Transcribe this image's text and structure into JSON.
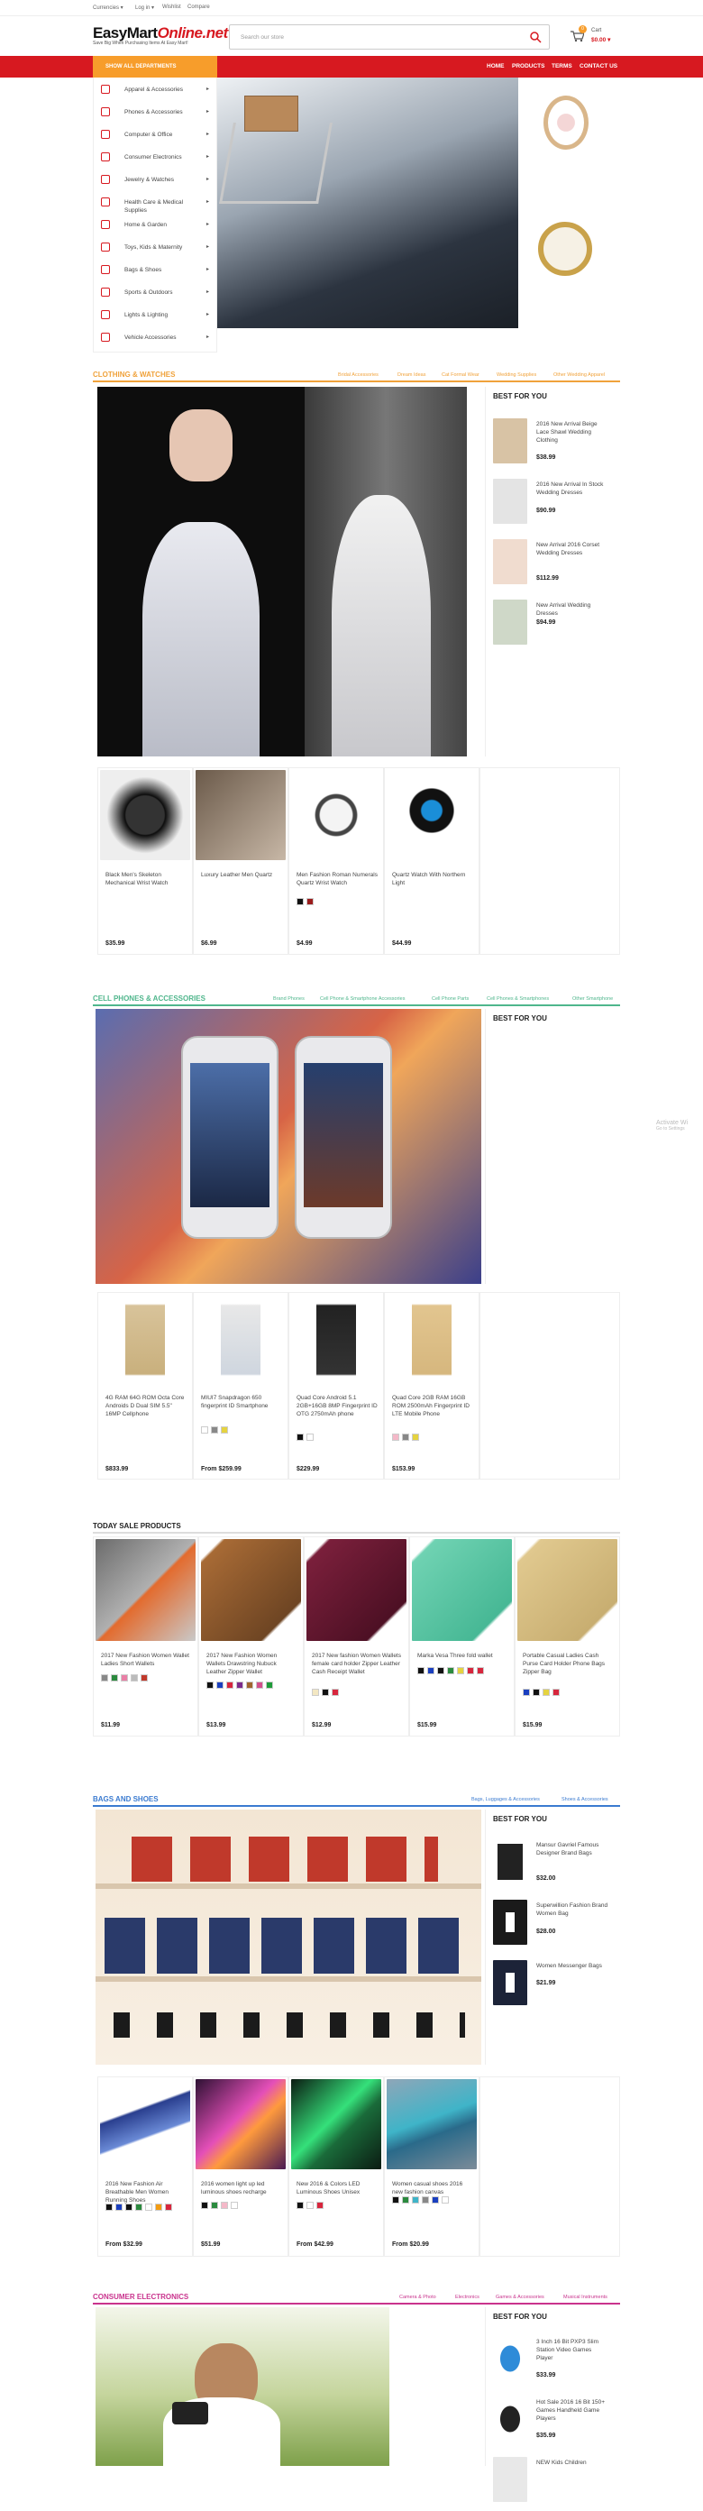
{
  "topbar": {
    "currency": "Currencies ▾",
    "login": "Log in ▾",
    "wishlist": "Wishlist",
    "compare": "Compare"
  },
  "logo": {
    "easy": "EasyMart",
    "online": "Online.net",
    "tagline": "Save Big When Purchasing Items At Easy Mart!"
  },
  "search": {
    "placeholder": "Search our store"
  },
  "cart": {
    "count": "0",
    "label": "Cart",
    "total": "$0.00 ▾"
  },
  "nav": {
    "all_departments": "SHOW ALL DEPARTMENTS",
    "items": [
      "HOME",
      "PRODUCTS",
      "TERMS",
      "CONTACT US"
    ]
  },
  "sidemenu": [
    "Apparel & Accessories",
    "Phones & Accessories",
    "Computer & Office",
    "Consumer Electronics",
    "Jewelry & Watches",
    "Health Care & Medical Supplies",
    "Home & Garden",
    "Toys, Kids & Maternity",
    "Bags & Shoes",
    "Sports & Outdoors",
    "Lights & Lighting",
    "Vehicle Accessories"
  ],
  "watermark": {
    "line1": "Activate Wi",
    "line2": "Go to Settings"
  },
  "clothing": {
    "title": "CLOTHING & WATCHES",
    "color": "#f0a23b",
    "tabs": [
      "Bridal Accessories",
      "Dream Ideas",
      "Cat Formal Wear",
      "Wedding Supplies",
      "Other Wedding Apparel"
    ],
    "best_for_you": "BEST FOR YOU",
    "bfy": [
      {
        "title": "2016 New Arrival Beige Lace Shawl Wedding Clothing",
        "price": "$38.99"
      },
      {
        "title": "2016 New Arrival In Stock Wedding Dresses",
        "price": "$90.99"
      },
      {
        "title": "New Arrival 2016 Corset Wedding Dresses",
        "price": "$112.99"
      },
      {
        "title": "New Arrival Wedding Dresses",
        "price": "$94.99"
      }
    ],
    "products": [
      {
        "title": "Black Men's Skeleton Mechanical Wrist Watch",
        "price": "$35.99"
      },
      {
        "title": "Luxury Leather Men Quartz",
        "price": "$6.99"
      },
      {
        "title": "Men Fashion Roman Numerals Quartz Wrist Watch",
        "price": "$4.99"
      },
      {
        "title": "Quartz Watch With Northern Light",
        "price": "$44.99"
      }
    ]
  },
  "phones": {
    "title": "CELL PHONES & ACCESSORIES",
    "color": "#4fb68c",
    "tabs": [
      "Brand Phones",
      "Cell Phone & Smartphone Accessories",
      "Cell Phone Parts",
      "Cell Phones & Smartphones",
      "Other Smartphone"
    ],
    "best_for_you": "BEST FOR YOU",
    "products": [
      {
        "title": "4G RAM 64G ROM Octa Core Androids D Dual SIM 5.5\" 16MP Cellphone",
        "price": "$833.99"
      },
      {
        "title": "MIUI7 Snapdragon 650 fingerprint ID Smartphone",
        "price": "From $259.99"
      },
      {
        "title": "Quad Core Android 5.1 2GB+16GB 8MP Fingerprint ID OTG 2750mAh phone",
        "price": "$229.99"
      },
      {
        "title": "Quad Core 2GB RAM 16GB ROM 2500mAh Fingerprint ID LTE Mobile Phone",
        "price": "$153.99"
      }
    ]
  },
  "today": {
    "title": "TODAY SALE PRODUCTS",
    "products": [
      {
        "title": "2017 New Fashion Women Wallet Ladies Short Wallets",
        "price": "$11.99"
      },
      {
        "title": "2017 New Fashion Women Wallets Drawstring Nubuck Leather Zipper Wallet",
        "price": "$13.99"
      },
      {
        "title": "2017 New fashion Women Wallets female card holder Zipper Leather Cash Receipt Wallet",
        "price": "$12.99"
      },
      {
        "title": "Marka Vesa Three fold wallet",
        "price": "$15.99"
      },
      {
        "title": "Portable Casual Ladies Cash Purse Card Holder Phone Bags Zipper Bag",
        "price": "$15.99"
      }
    ]
  },
  "bags": {
    "title": "BAGS AND SHOES",
    "color": "#3b7bd0",
    "tabs": [
      "Bags, Luggages & Accessories",
      "Shoes & Accessories"
    ],
    "best_for_you": "BEST FOR YOU",
    "bfy": [
      {
        "title": "Mansur Gavriel Famous Designer Brand Bags",
        "price": "$32.00"
      },
      {
        "title": "Superwillion Fashion Brand Women Bag",
        "price": "$28.00"
      },
      {
        "title": "Women Messenger Bags",
        "price": "$21.99"
      }
    ],
    "products": [
      {
        "title": "2016 New Fashion Air Breathable Men Women Running Shoes",
        "price": "From $32.99"
      },
      {
        "title": "2016 women light up led luminous shoes recharge",
        "price": "$51.99"
      },
      {
        "title": "New 2016 & Colors LED Luminous Shoes Unisex",
        "price": "From $42.99"
      },
      {
        "title": "Women casual shoes 2016 new fashion canvas",
        "price": "From $20.99"
      }
    ]
  },
  "electronics": {
    "title": "CONSUMER ELECTRONICS",
    "color": "#c9338d",
    "tabs": [
      "Camera & Photo",
      "Electronics",
      "Games & Accessories",
      "Musical Instruments"
    ],
    "best_for_you": "BEST FOR YOU",
    "bfy": [
      {
        "title": "3 Inch 16 Bit PXP3 Slim Station Video Games Player",
        "price": "$33.99"
      },
      {
        "title": "Hot Sale 2016 16 Bit 150+ Games Handheld Game Players",
        "price": "$35.99"
      },
      {
        "title": "NEW Kids Children",
        "price": ""
      }
    ]
  }
}
